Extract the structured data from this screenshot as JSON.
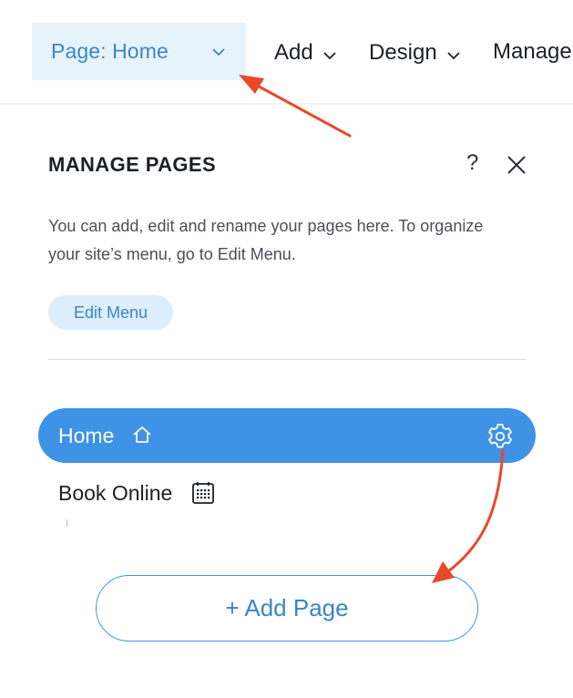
{
  "topbar": {
    "page_selector_label": "Page: Home",
    "menu": [
      {
        "label": "Add"
      },
      {
        "label": "Design"
      },
      {
        "label": "Manage"
      }
    ]
  },
  "panel": {
    "title": "MANAGE PAGES",
    "help_label": "?",
    "description": "You can add, edit and rename your pages here. To organize your site’s menu, go to Edit Menu.",
    "edit_menu_label": "Edit Menu"
  },
  "pages": [
    {
      "name": "Home",
      "icon": "home-icon",
      "selected": true
    },
    {
      "name": "Book Online",
      "icon": "calendar-icon",
      "selected": false
    }
  ],
  "add_page_label": "+ Add Page",
  "colors": {
    "accent": "#3e93e6",
    "accent_text": "#3a85c8",
    "selector_bg": "#e7f3fb",
    "chip_bg": "#dcedfb",
    "annotation_arrow": "#e8492a"
  }
}
